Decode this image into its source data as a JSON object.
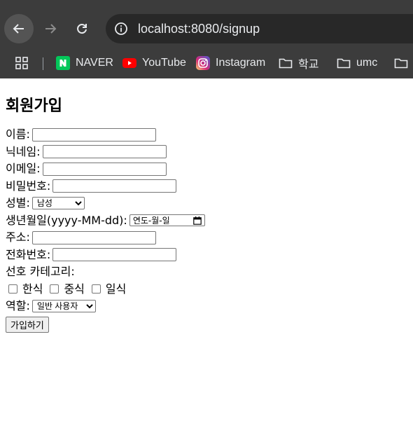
{
  "browser": {
    "url_host": "localhost",
    "url_path": ":8080/signup",
    "bookmarks": [
      {
        "label": "NAVER",
        "icon": "naver-icon"
      },
      {
        "label": "YouTube",
        "icon": "youtube-icon"
      },
      {
        "label": "Instagram",
        "icon": "instagram-icon"
      },
      {
        "label": "학교",
        "icon": "folder-icon"
      },
      {
        "label": "umc",
        "icon": "folder-icon"
      }
    ]
  },
  "form": {
    "title": "회원가입",
    "name_label": "이름:",
    "nickname_label": "닉네임:",
    "email_label": "이메일:",
    "password_label": "비밀번호:",
    "gender_label": "성별:",
    "gender_value": "남성",
    "birth_label": "생년월일(yyyy-MM-dd):",
    "birth_placeholder": "연도-월-일",
    "address_label": "주소:",
    "phone_label": "전화번호:",
    "category_label": "선호 카테고리:",
    "categories": [
      "한식",
      "중식",
      "일식"
    ],
    "role_label": "역할:",
    "role_value": "일반 사용자",
    "submit_label": "가입하기"
  },
  "colors": {
    "chrome_bg": "#3c3c3c",
    "omnibox_bg": "#282828",
    "naver_green": "#03c75a",
    "youtube_red": "#ff0000"
  }
}
